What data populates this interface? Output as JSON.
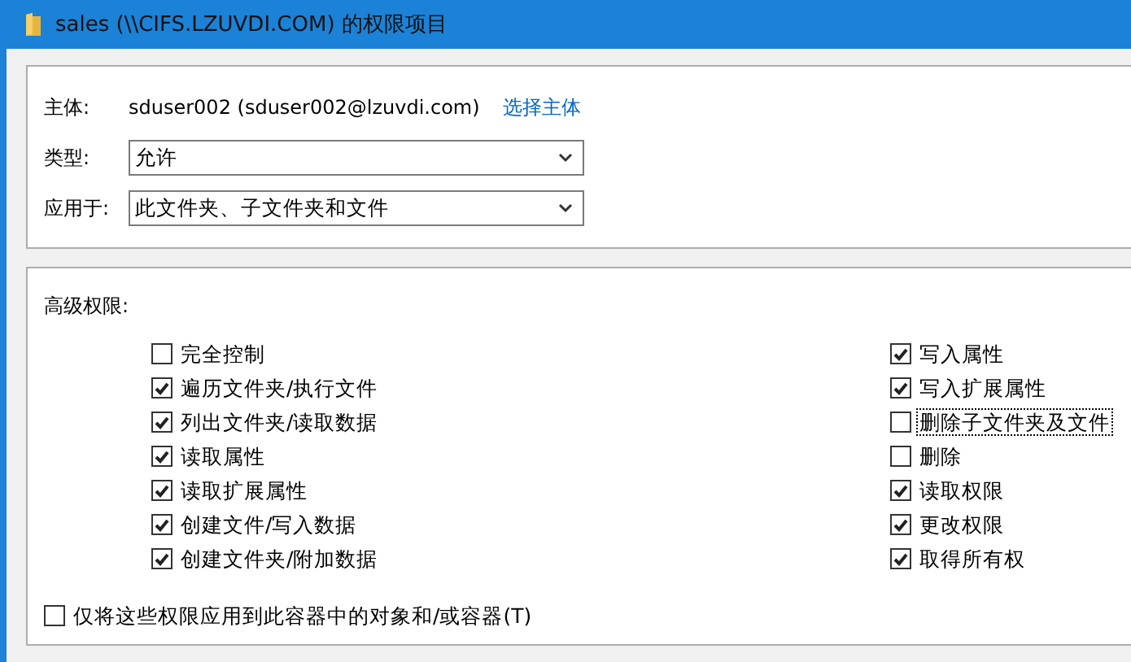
{
  "window": {
    "title": "sales (\\\\CIFS.LZUVDI.COM) 的权限项目"
  },
  "principal": {
    "label": "主体:",
    "value": "sduser002 (sduser002@lzuvdi.com)",
    "link": "选择主体"
  },
  "type": {
    "label": "类型:",
    "value": "允许"
  },
  "applies_to": {
    "label": "应用于:",
    "value": "此文件夹、子文件夹和文件"
  },
  "advanced": {
    "heading": "高级权限:",
    "left": [
      {
        "label": "完全控制",
        "checked": false,
        "focused": false
      },
      {
        "label": "遍历文件夹/执行文件",
        "checked": true,
        "focused": false
      },
      {
        "label": "列出文件夹/读取数据",
        "checked": true,
        "focused": false
      },
      {
        "label": "读取属性",
        "checked": true,
        "focused": false
      },
      {
        "label": "读取扩展属性",
        "checked": true,
        "focused": false
      },
      {
        "label": "创建文件/写入数据",
        "checked": true,
        "focused": false
      },
      {
        "label": "创建文件夹/附加数据",
        "checked": true,
        "focused": false
      }
    ],
    "right": [
      {
        "label": "写入属性",
        "checked": true,
        "focused": false
      },
      {
        "label": "写入扩展属性",
        "checked": true,
        "focused": false
      },
      {
        "label": "删除子文件夹及文件",
        "checked": false,
        "focused": true
      },
      {
        "label": "删除",
        "checked": false,
        "focused": false
      },
      {
        "label": "读取权限",
        "checked": true,
        "focused": false
      },
      {
        "label": "更改权限",
        "checked": true,
        "focused": false
      },
      {
        "label": "取得所有权",
        "checked": true,
        "focused": false
      }
    ]
  },
  "apply_only": {
    "label": "仅将这些权限应用到此容器中的对象和/或容器(T)",
    "checked": false
  }
}
